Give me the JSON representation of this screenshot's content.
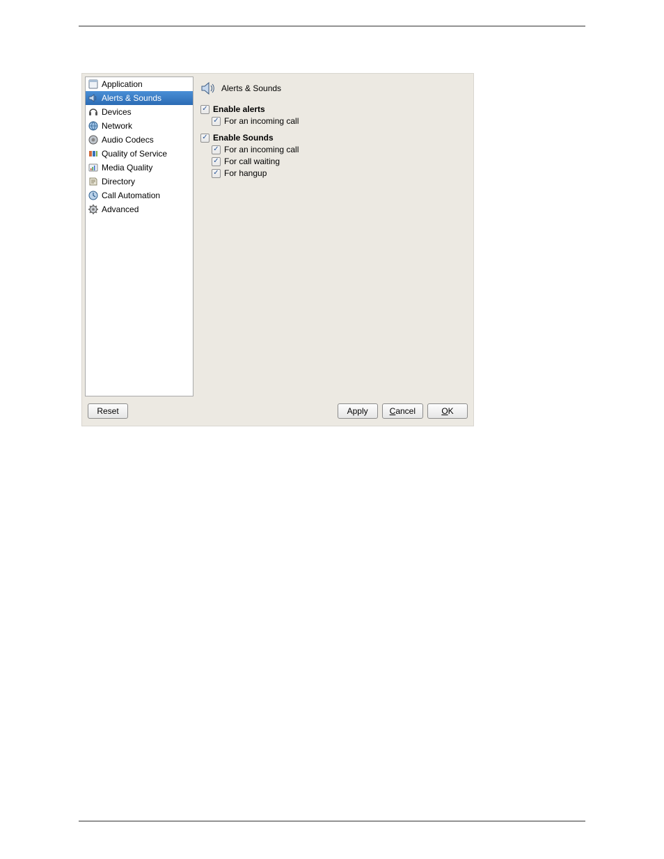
{
  "sidebar": {
    "items": [
      {
        "label": "Application",
        "icon": "window-icon",
        "selected": false
      },
      {
        "label": "Alerts & Sounds",
        "icon": "speaker-icon",
        "selected": true
      },
      {
        "label": "Devices",
        "icon": "headset-icon",
        "selected": false
      },
      {
        "label": "Network",
        "icon": "globe-icon",
        "selected": false
      },
      {
        "label": "Audio Codecs",
        "icon": "codec-icon",
        "selected": false
      },
      {
        "label": "Quality of Service",
        "icon": "qos-icon",
        "selected": false
      },
      {
        "label": "Media Quality",
        "icon": "media-quality-icon",
        "selected": false
      },
      {
        "label": "Directory",
        "icon": "directory-icon",
        "selected": false
      },
      {
        "label": "Call Automation",
        "icon": "automation-icon",
        "selected": false
      },
      {
        "label": "Advanced",
        "icon": "gear-icon",
        "selected": false
      }
    ]
  },
  "content": {
    "title": "Alerts & Sounds",
    "groups": [
      {
        "header": {
          "label": "Enable alerts",
          "checked": true
        },
        "subs": [
          {
            "label": "For an incoming call",
            "checked": true
          }
        ]
      },
      {
        "header": {
          "label": "Enable Sounds",
          "checked": true
        },
        "subs": [
          {
            "label": "For an incoming call",
            "checked": true
          },
          {
            "label": "For call waiting",
            "checked": true
          },
          {
            "label": "For hangup",
            "checked": true
          }
        ]
      }
    ]
  },
  "buttons": {
    "reset": "Reset",
    "apply": "Apply",
    "cancel": "Cancel",
    "ok": "OK",
    "cancel_mnemonic": "C",
    "ok_mnemonic": "O"
  }
}
